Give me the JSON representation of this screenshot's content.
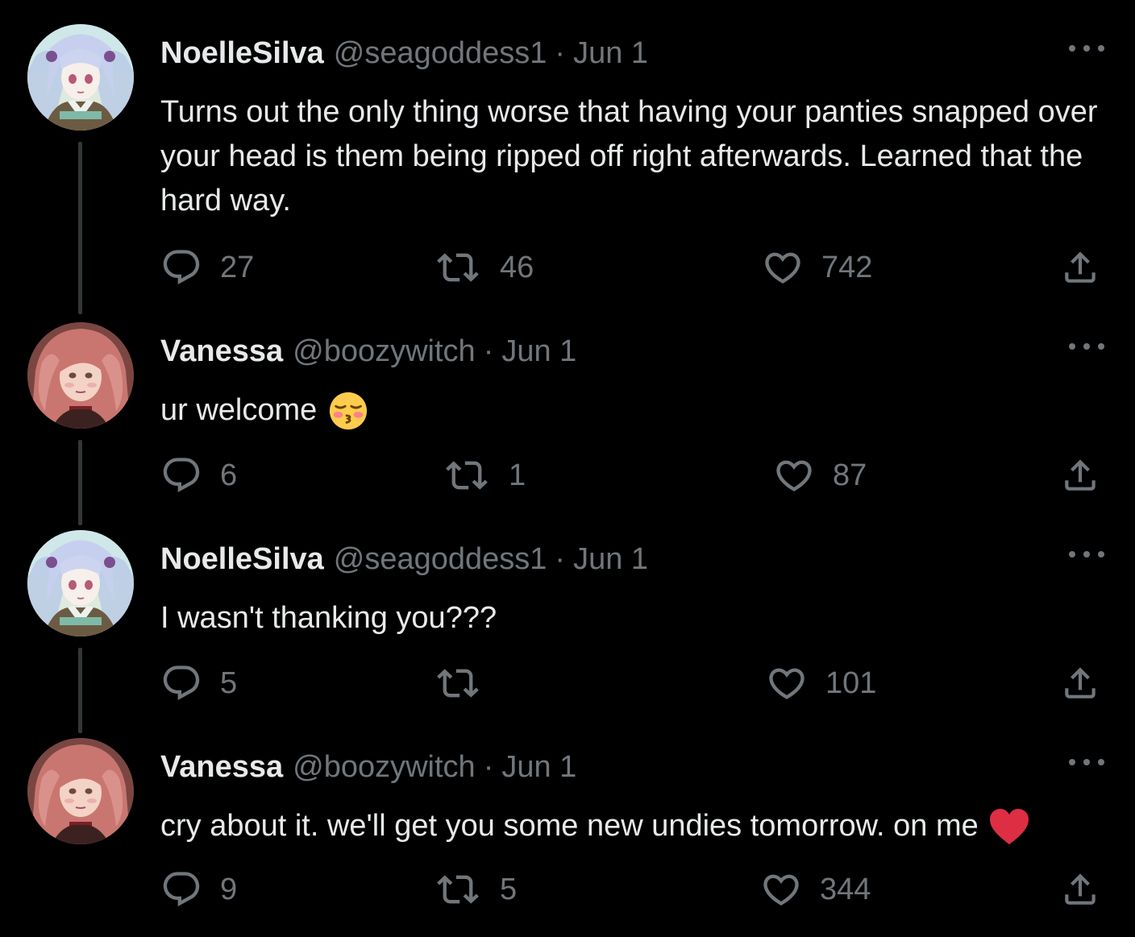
{
  "tweets": [
    {
      "display_name": "NoelleSilva",
      "handle": "@seagoddess1",
      "separator": "·",
      "date": "Jun 1",
      "text": "Turns out the only thing worse that having your panties snapped over your head is them being ripped off right afterwards. Learned that the hard way.",
      "replies": "27",
      "retweets": "46",
      "likes": "742",
      "avatar": "noelle-avatar"
    },
    {
      "display_name": "Vanessa",
      "handle": "@boozywitch",
      "separator": "·",
      "date": "Jun 1",
      "text": "ur welcome",
      "emoji": "kissing-face-with-closed-eyes-emoji",
      "replies": "6",
      "retweets": "1",
      "likes": "87",
      "avatar": "vanessa-avatar"
    },
    {
      "display_name": "NoelleSilva",
      "handle": "@seagoddess1",
      "separator": "·",
      "date": "Jun 1",
      "text": "I wasn't thanking you???",
      "replies": "5",
      "retweets": "",
      "likes": "101",
      "avatar": "noelle-avatar"
    },
    {
      "display_name": "Vanessa",
      "handle": "@boozywitch",
      "separator": "·",
      "date": "Jun 1",
      "text": "cry about it. we'll get you some new undies tomorrow. on me",
      "emoji": "red-heart-emoji",
      "replies": "9",
      "retweets": "5",
      "likes": "344",
      "avatar": "vanessa-avatar"
    }
  ],
  "colors": {
    "background": "#000000",
    "primary_text": "#e7e9ea",
    "secondary_text": "#71767b",
    "thread_line": "#333639",
    "heart": "#f91880"
  },
  "icons": [
    "reply-icon",
    "retweet-icon",
    "like-icon",
    "share-icon",
    "more-icon"
  ]
}
